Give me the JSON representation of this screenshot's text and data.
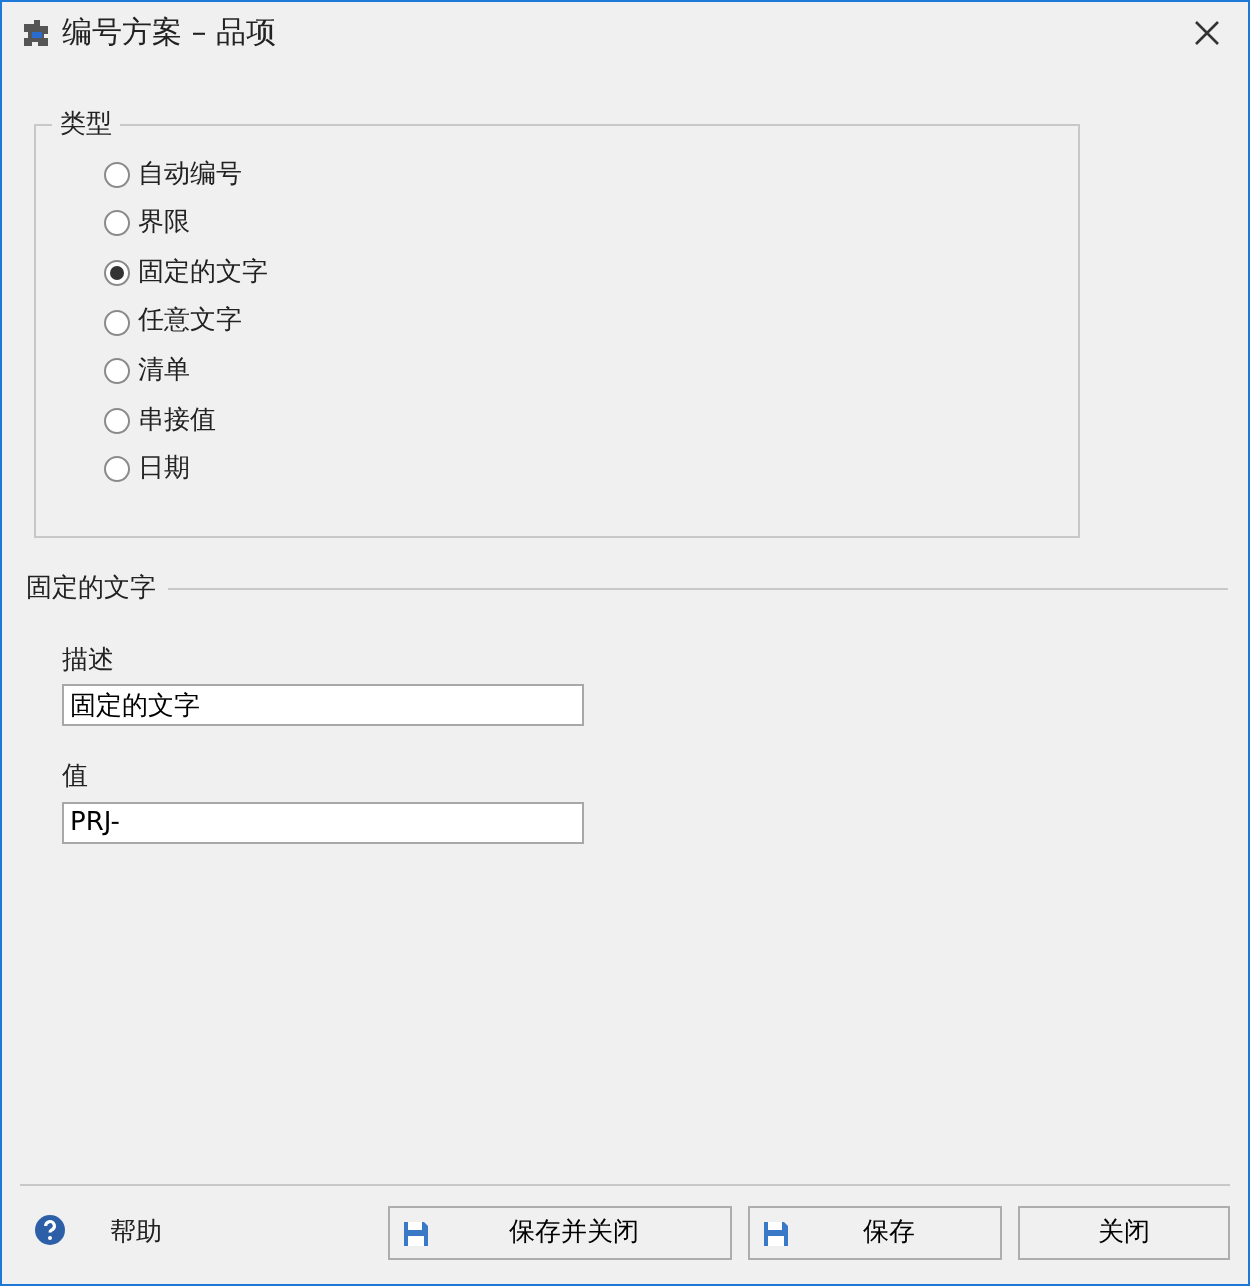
{
  "window": {
    "title": "编号方案 – 品项"
  },
  "type_group": {
    "title": "类型",
    "options": [
      {
        "label": "自动编号",
        "selected": false
      },
      {
        "label": "界限",
        "selected": false
      },
      {
        "label": "固定的文字",
        "selected": true
      },
      {
        "label": "任意文字",
        "selected": false
      },
      {
        "label": "清单",
        "selected": false
      },
      {
        "label": "串接值",
        "selected": false
      },
      {
        "label": "日期",
        "selected": false
      }
    ]
  },
  "section": {
    "title": "固定的文字",
    "fields": [
      {
        "label": "描述",
        "value": "固定的文字"
      },
      {
        "label": "值",
        "value": "PRJ-"
      }
    ]
  },
  "footer": {
    "help": "帮助",
    "buttons": [
      {
        "kind": "save",
        "label": "保存并关闭"
      },
      {
        "kind": "save",
        "label": "保存"
      },
      {
        "kind": "plain",
        "label": "关闭"
      }
    ]
  }
}
